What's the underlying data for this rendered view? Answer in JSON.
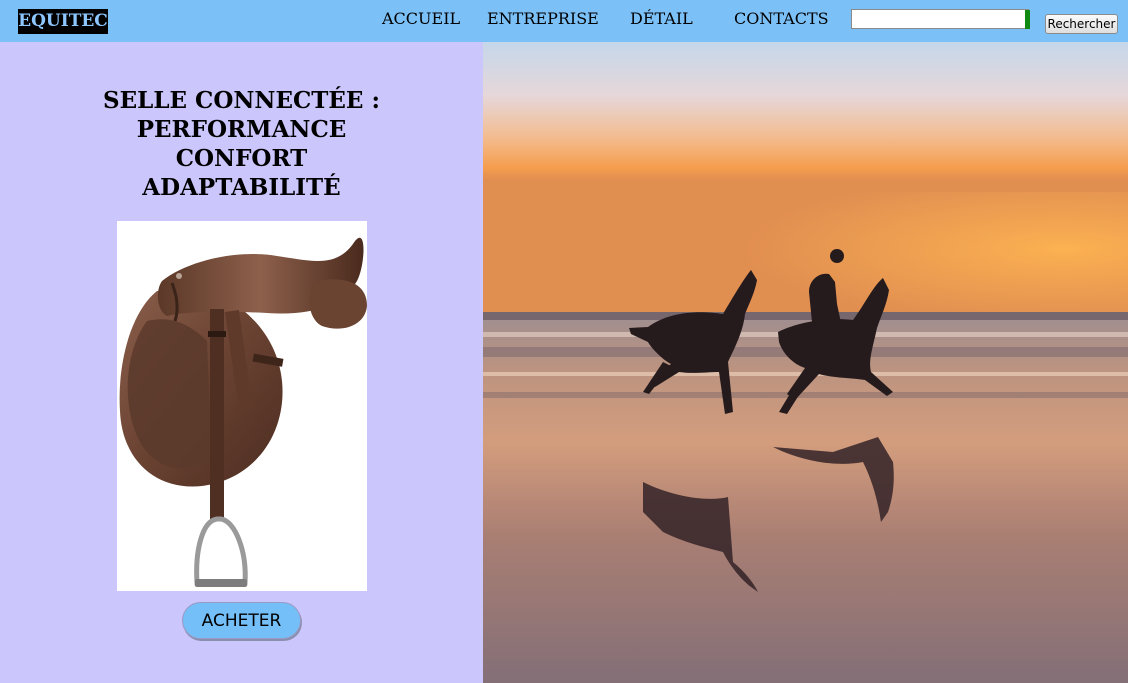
{
  "header": {
    "logo": "EQUITEC",
    "nav": [
      "ACCUEIL",
      "ENTREPRISE",
      "DÉTAIL",
      "CONTACTS"
    ],
    "search": {
      "value": "",
      "placeholder": ""
    },
    "search_button": "Rechercher"
  },
  "main": {
    "headline": [
      "SELLE CONNECTÉE :",
      "PERFORMANCE",
      "CONFORT",
      "ADAPTABILITÉ"
    ],
    "buy_button": "ACHETER"
  },
  "colors": {
    "topbar": "#7bc1f8",
    "panel": "#cbc6fb",
    "logo_bg": "#000000",
    "logo_text": "#8ec7ff",
    "button": "#74bff8",
    "sunset": "#f39a4a"
  },
  "images": {
    "product": "saddle-photo",
    "hero": "horses-galloping-beach-sunset"
  }
}
